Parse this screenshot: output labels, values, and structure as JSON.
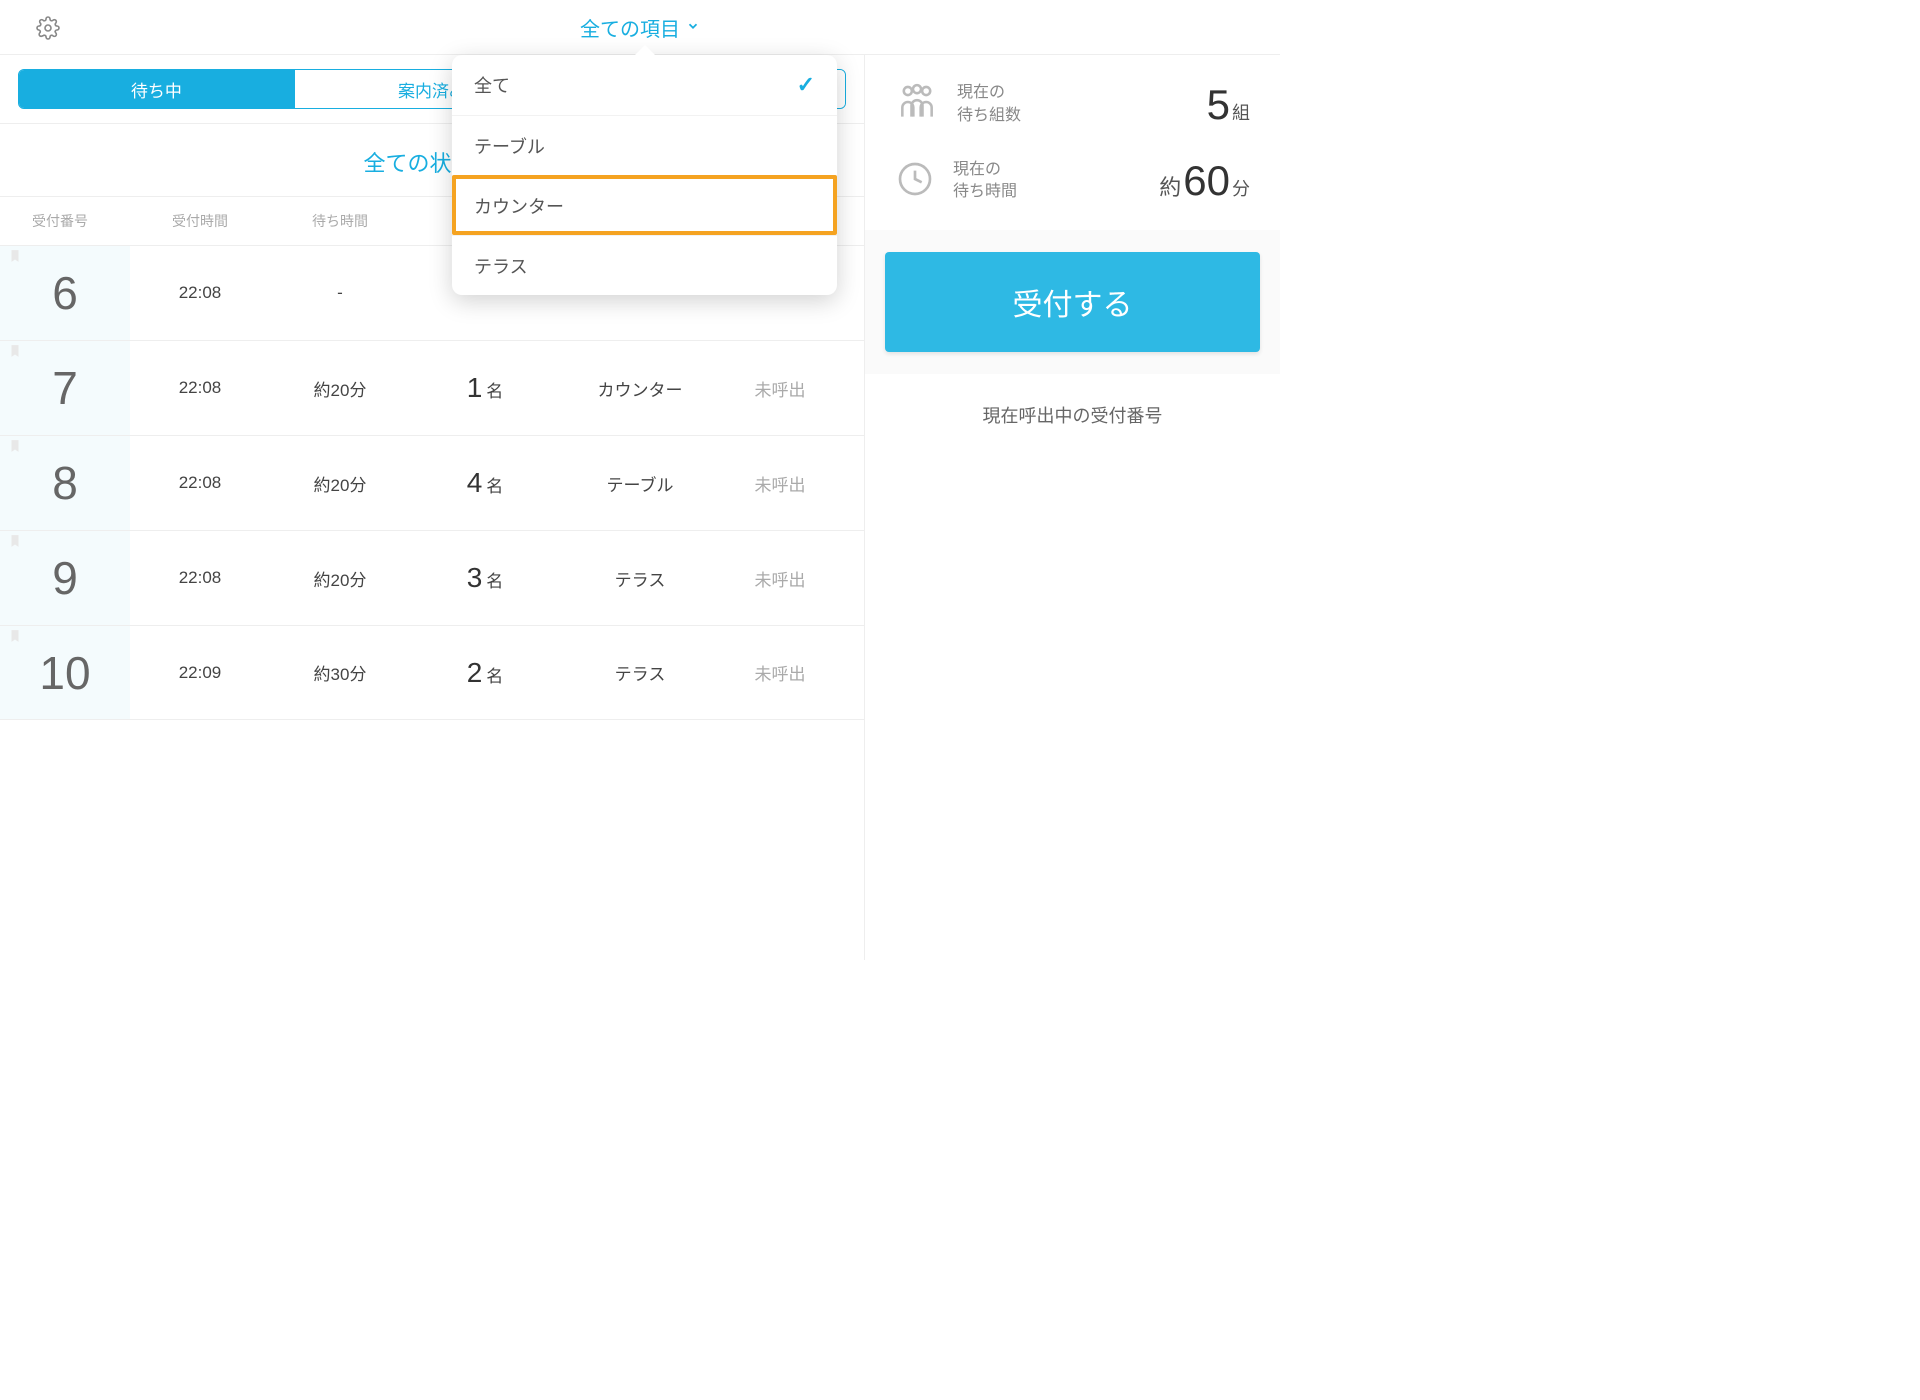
{
  "header": {
    "title": "全ての項目"
  },
  "tabs": {
    "waiting": "待ち中",
    "guided": "案内済み"
  },
  "dropdown": {
    "items": [
      {
        "label": "全て",
        "selected": true,
        "highlight": false
      },
      {
        "label": "テーブル",
        "selected": false,
        "highlight": false
      },
      {
        "label": "カウンター",
        "selected": false,
        "highlight": true
      },
      {
        "label": "テラス",
        "selected": false,
        "highlight": false
      }
    ]
  },
  "status_header": "全ての状態(5)",
  "columns": {
    "number": "受付番号",
    "time": "受付時間",
    "wait": "待ち時間"
  },
  "rows": [
    {
      "num": "6",
      "time": "22:08",
      "wait": "-",
      "party_n": "",
      "party_suffix": "",
      "seat": "",
      "status": ""
    },
    {
      "num": "7",
      "time": "22:08",
      "wait": "約20分",
      "party_n": "1",
      "party_suffix": "名",
      "seat": "カウンター",
      "status": "未呼出"
    },
    {
      "num": "8",
      "time": "22:08",
      "wait": "約20分",
      "party_n": "4",
      "party_suffix": "名",
      "seat": "テーブル",
      "status": "未呼出"
    },
    {
      "num": "9",
      "time": "22:08",
      "wait": "約20分",
      "party_n": "3",
      "party_suffix": "名",
      "seat": "テラス",
      "status": "未呼出"
    },
    {
      "num": "10",
      "time": "22:09",
      "wait": "約30分",
      "party_n": "2",
      "party_suffix": "名",
      "seat": "テラス",
      "status": "未呼出"
    }
  ],
  "stats": {
    "groups_label_1": "現在の",
    "groups_label_2": "待ち組数",
    "groups_value": "5",
    "groups_unit": "組",
    "wait_label_1": "現在の",
    "wait_label_2": "待ち時間",
    "wait_prefix": "約",
    "wait_value": "60",
    "wait_unit": "分"
  },
  "accept_button": "受付する",
  "calling_header": "現在呼出中の受付番号"
}
